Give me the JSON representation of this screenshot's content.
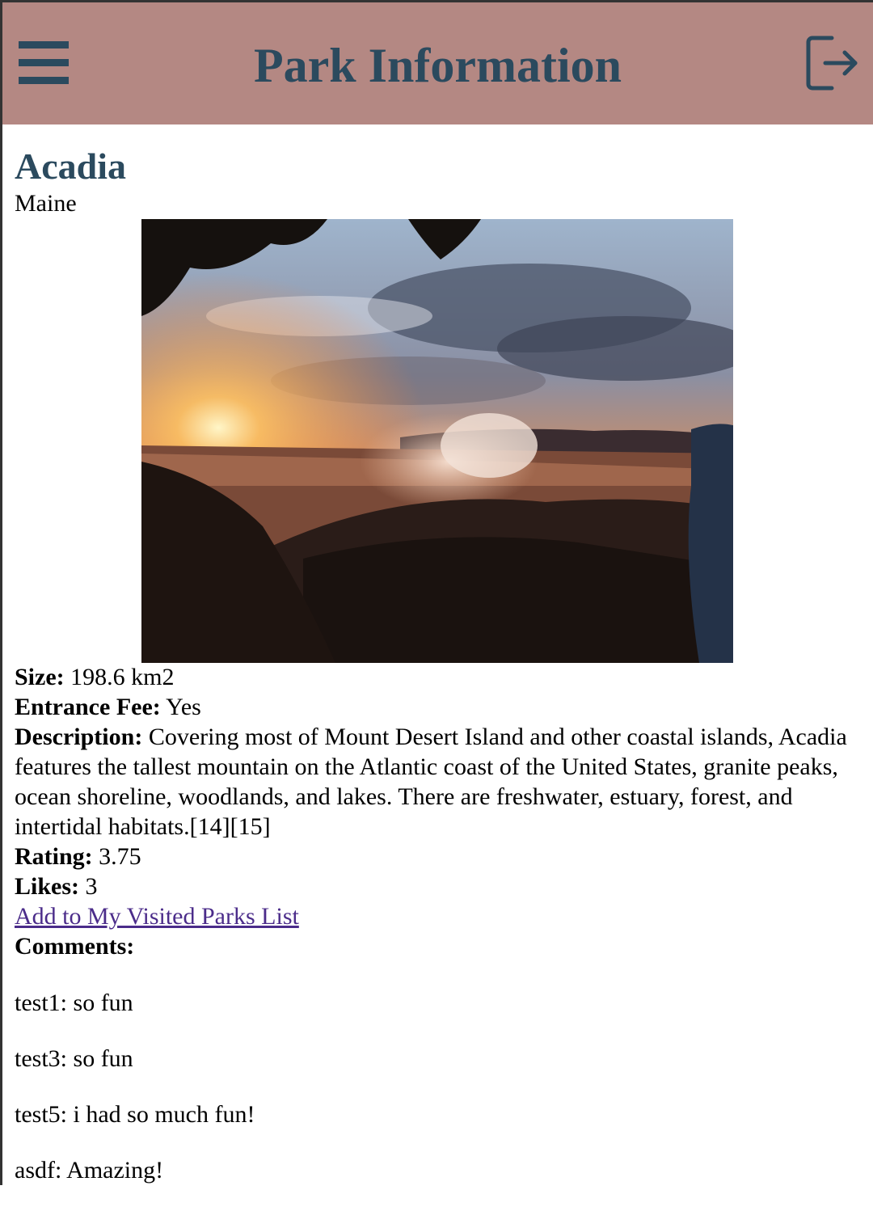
{
  "header": {
    "title": "Park Information",
    "menu_icon": "hamburger-menu-icon",
    "logout_icon": "logout-icon",
    "color": "#b48883",
    "accent": "#2b4a5e"
  },
  "park": {
    "name": "Acadia",
    "state": "Maine",
    "size_label": "Size:",
    "size_value": "198.6 km2",
    "fee_label": "Entrance Fee:",
    "fee_value": "Yes",
    "description_label": "Description:",
    "description_value": "Covering most of Mount Desert Island and other coastal islands, Acadia features the tallest mountain on the Atlantic coast of the United States, granite peaks, ocean shoreline, woodlands, and lakes. There are freshwater, estuary, forest, and intertidal habitats.[14][15]",
    "rating_label": "Rating:",
    "rating_value": "3.75",
    "likes_label": "Likes:",
    "likes_value": "3",
    "add_link": "Add to My Visited Parks List",
    "comments_label": "Comments:"
  },
  "comments": [
    {
      "user": "test1",
      "text": "so fun"
    },
    {
      "user": "test3",
      "text": "so fun"
    },
    {
      "user": "test5",
      "text": "i had so much fun!"
    },
    {
      "user": "asdf",
      "text": "Amazing!"
    }
  ]
}
